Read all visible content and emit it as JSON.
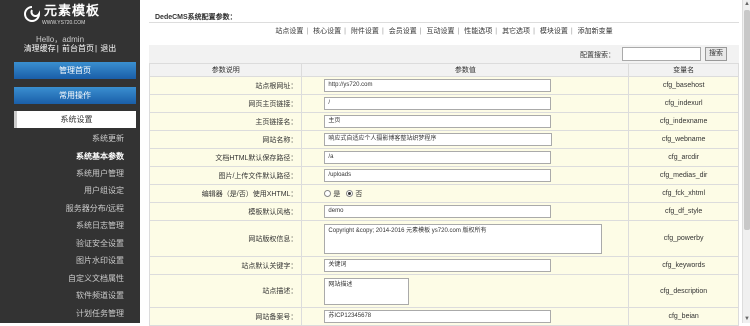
{
  "brand": {
    "name": "元素模板",
    "site": "WWW.YS720.COM",
    "icon": "swirl-logo-icon"
  },
  "user": {
    "greeting": "Hello，admin"
  },
  "top_links": [
    "清理缓存",
    "前台首页",
    "退出"
  ],
  "sidebar": {
    "main_menu": "管理首页",
    "common_ops": "常用操作",
    "system_settings": "系统设置",
    "items": [
      "系统更新",
      "系统基本参数",
      "系统用户管理",
      "用户组设定",
      "服务器分布/远程",
      "系统日志管理",
      "验证安全设置",
      "图片水印设置",
      "自定义文档属性",
      "软件频道设置",
      "计划任务管理"
    ],
    "active_index": 1
  },
  "page": {
    "title": "DedeCMS系统配置参数："
  },
  "tabs": [
    "站点设置",
    "核心设置",
    "附件设置",
    "会员设置",
    "互动设置",
    "性能选项",
    "其它选项",
    "模块设置",
    "添加新变量"
  ],
  "search": {
    "label": "配置搜索：",
    "value": "",
    "button": "搜索"
  },
  "table": {
    "headers": [
      "参数说明",
      "参数值",
      "变量名"
    ],
    "rows": [
      {
        "label": "站点根网址：",
        "value": "http://ys720.com",
        "var": "cfg_basehost"
      },
      {
        "label": "网页主页链接：",
        "value": "/",
        "var": "cfg_indexurl"
      },
      {
        "label": "主页链接名：",
        "value": "主页",
        "var": "cfg_indexname"
      },
      {
        "label": "网站名称：",
        "value": "响应式自适应个人摄影博客整站织梦程序",
        "var": "cfg_webname"
      },
      {
        "label": "文档HTML默认保存路径：",
        "value": "/a",
        "var": "cfg_arcdir"
      },
      {
        "label": "图片/上传文件默认路径：",
        "value": "/uploads",
        "var": "cfg_medias_dir"
      },
      {
        "label": "编辑器（是/否）使用XHTML：",
        "radio": [
          "是",
          "否"
        ],
        "selected": "否",
        "var": "cfg_fck_xhtml"
      },
      {
        "label": "模板默认风格：",
        "value": "demo",
        "var": "cfg_df_style"
      },
      {
        "label": "网站版权信息：",
        "textarea": "Copyright &copy; 2014-2016  元素模板 ys720.com  版权所有",
        "var": "cfg_powerby"
      },
      {
        "label": "站点默认关键字：",
        "value": "关键词",
        "var": "cfg_keywords"
      },
      {
        "label": "站点描述：",
        "textarea": "网站描述",
        "var": "cfg_description"
      },
      {
        "label": "网站备案号：",
        "value": "苏ICP12345678",
        "var": "cfg_beian"
      }
    ]
  }
}
